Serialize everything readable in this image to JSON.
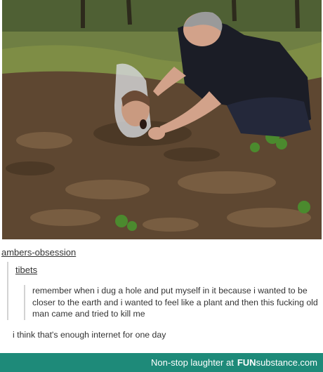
{
  "post": {
    "blog_name": "ambers-obsession",
    "reply_blog": "tibets",
    "reply_text": "remember when i dug a hole and put myself in it because i wanted to be closer to the earth and i wanted to feel like a plant and then this fucking old man came and tried to kill me",
    "followup_text": "i think that's enough internet for one day"
  },
  "footer": {
    "tagline": "Non-stop laughter at",
    "brand_bold": "FUN",
    "brand_rest": "substance.com",
    "background": "#1e8a79"
  }
}
